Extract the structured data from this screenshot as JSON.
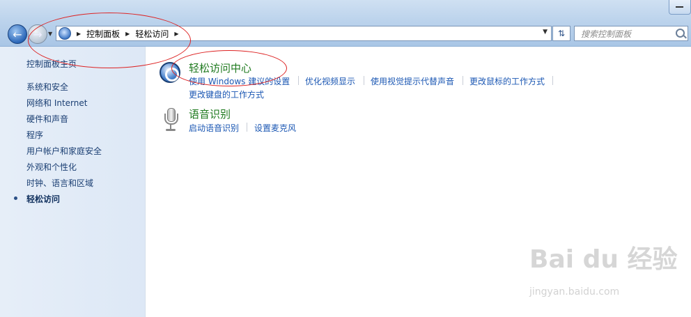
{
  "address_bar": {
    "breadcrumbs": [
      "控制面板",
      "轻松访问"
    ]
  },
  "search": {
    "placeholder": "搜索控制面板"
  },
  "sidebar": {
    "home": "控制面板主页",
    "items": [
      {
        "label": "系统和安全"
      },
      {
        "label": "网络和 Internet"
      },
      {
        "label": "硬件和声音"
      },
      {
        "label": "程序"
      },
      {
        "label": "用户帐户和家庭安全"
      },
      {
        "label": "外观和个性化"
      },
      {
        "label": "时钟、语言和区域"
      },
      {
        "label": "轻松访问",
        "current": true
      }
    ]
  },
  "categories": [
    {
      "title": "轻松访问中心",
      "icon": "ease-of-access-icon",
      "links": [
        "使用 Windows 建议的设置",
        "优化视频显示",
        "使用视觉提示代替声音",
        "更改鼠标的工作方式",
        "更改键盘的工作方式"
      ]
    },
    {
      "title": "语音识别",
      "icon": "microphone-icon",
      "links": [
        "启动语音识别",
        "设置麦克风"
      ]
    }
  ],
  "watermark": {
    "brand": "Bai du 经验",
    "url": "jingyan.baidu.com"
  },
  "colors": {
    "link": "#1b57b3",
    "category_title": "#1f7a1f",
    "annotation": "#d22"
  }
}
